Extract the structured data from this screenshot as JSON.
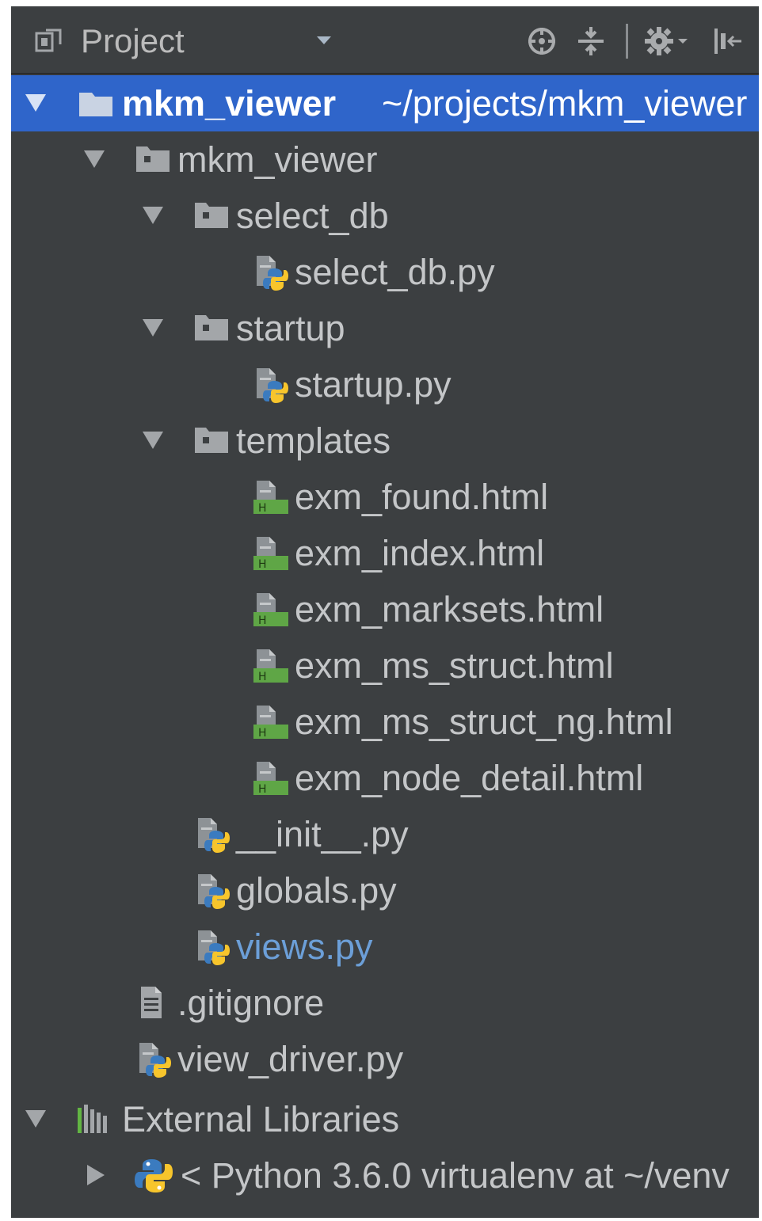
{
  "panel": {
    "title": "Project",
    "toolbar": {
      "icons": [
        "locate-icon",
        "collapse-all-icon",
        "settings-icon",
        "hide-panel-icon"
      ]
    }
  },
  "tree": {
    "root": {
      "name": "mkm_viewer",
      "path": "~/projects/mkm_viewer"
    },
    "items": [
      {
        "label": "mkm_viewer",
        "type": "folder"
      },
      {
        "label": "select_db",
        "type": "folder"
      },
      {
        "label": "select_db.py",
        "type": "python-file"
      },
      {
        "label": "startup",
        "type": "folder"
      },
      {
        "label": "startup.py",
        "type": "python-file"
      },
      {
        "label": "templates",
        "type": "folder"
      },
      {
        "label": "exm_found.html",
        "type": "html-file"
      },
      {
        "label": "exm_index.html",
        "type": "html-file"
      },
      {
        "label": "exm_marksets.html",
        "type": "html-file"
      },
      {
        "label": "exm_ms_struct.html",
        "type": "html-file"
      },
      {
        "label": "exm_ms_struct_ng.html",
        "type": "html-file"
      },
      {
        "label": "exm_node_detail.html",
        "type": "html-file"
      },
      {
        "label": "__init__.py",
        "type": "python-file"
      },
      {
        "label": "globals.py",
        "type": "python-file"
      },
      {
        "label": "views.py",
        "type": "python-file",
        "modified": true
      },
      {
        "label": ".gitignore",
        "type": "text-file"
      },
      {
        "label": "view_driver.py",
        "type": "python-file"
      }
    ],
    "external_libraries": {
      "label": "External Libraries",
      "child": "< Python 3.6.0 virtualenv at ~/venv"
    }
  },
  "colors": {
    "background": "#3c3f41",
    "selection": "#2f65ca",
    "text": "#c4c6c8",
    "modified_text": "#6c9fd8",
    "folder_icon": "#a3a6a9",
    "python_yellow": "#f7c52c",
    "python_blue": "#3b7bbf",
    "html_green": "#5fa646"
  }
}
